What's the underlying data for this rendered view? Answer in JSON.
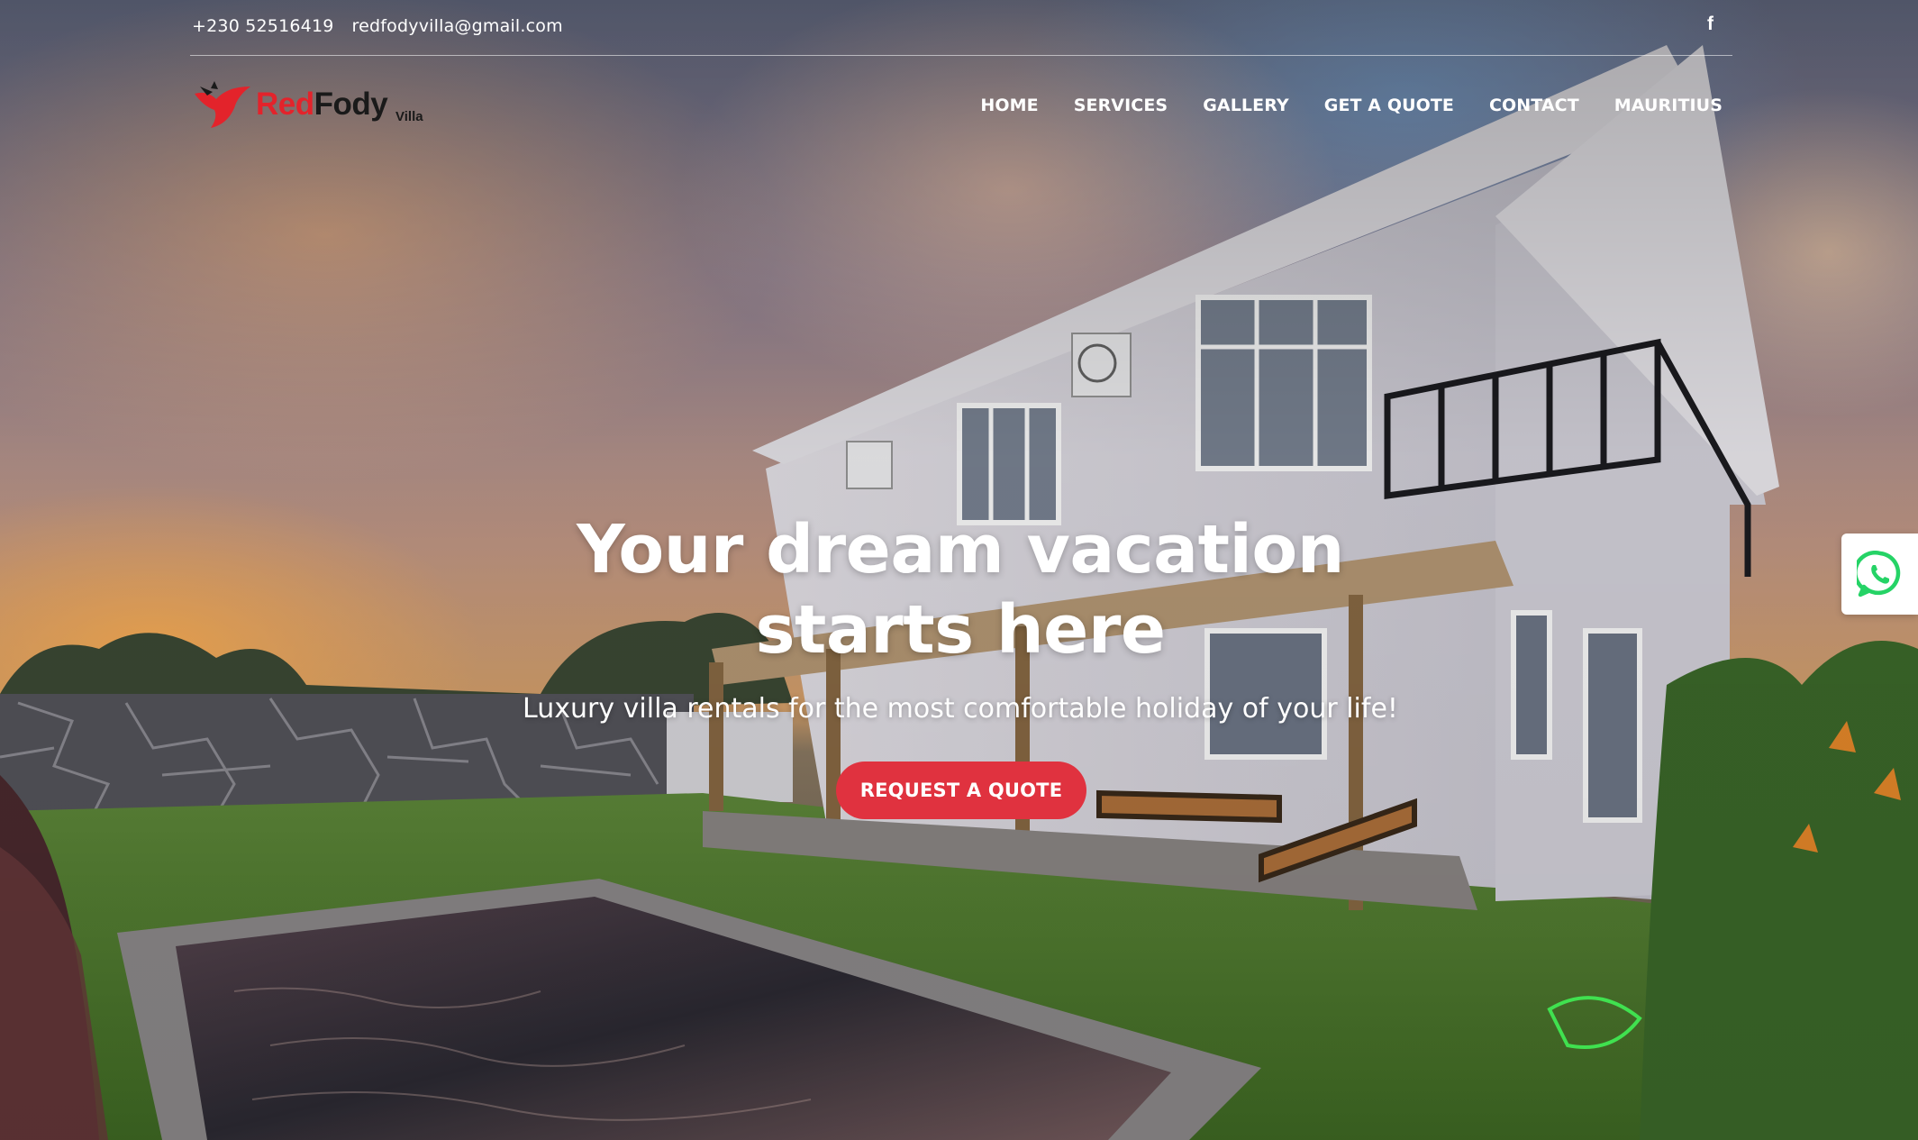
{
  "topbar": {
    "phone": "+230 52516419",
    "email": "redfodyvilla@gmail.com"
  },
  "logo": {
    "red_part": "Red",
    "dark_part": "Fody",
    "small_part": "Villa"
  },
  "nav": {
    "items": [
      "HOME",
      "SERVICES",
      "GALLERY",
      "GET A QUOTE",
      "CONTACT",
      "MAURITIUS"
    ]
  },
  "hero": {
    "title_line1": "Your dream vacation",
    "title_line2": "starts here",
    "subtitle": "Luxury villa rentals for the most comfortable holiday of your life!",
    "cta_label": "REQUEST A QUOTE"
  },
  "colors": {
    "accent": "#e0323f",
    "logo_red": "#e3232b",
    "whatsapp": "#25d366"
  },
  "icons": {
    "social": "facebook-icon",
    "floating": "whatsapp-icon",
    "logo_bird": "bird-logo-icon"
  }
}
